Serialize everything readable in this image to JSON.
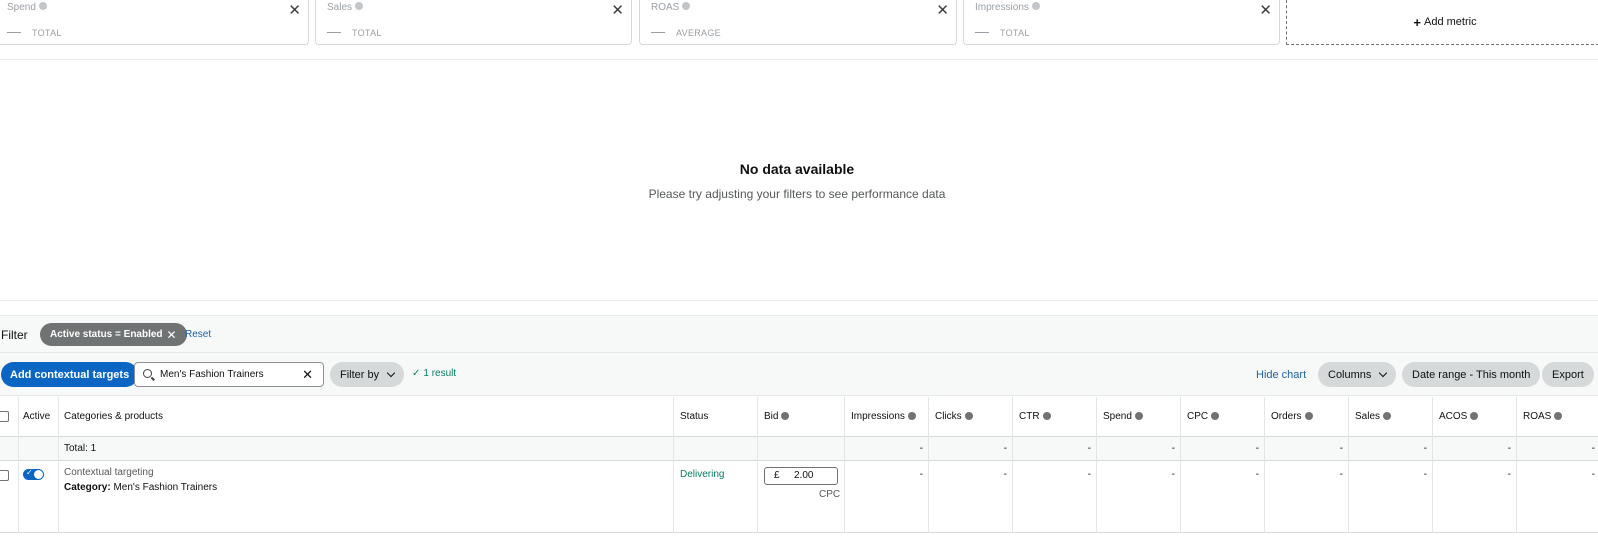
{
  "metrics": [
    {
      "name": "Spend",
      "aggregate": "TOTAL"
    },
    {
      "name": "Sales",
      "aggregate": "TOTAL"
    },
    {
      "name": "ROAS",
      "aggregate": "AVERAGE"
    },
    {
      "name": "Impressions",
      "aggregate": "TOTAL"
    }
  ],
  "add_metric_label": "Add metric",
  "chart": {
    "no_data_title": "No data available",
    "no_data_subtitle": "Please try adjusting your filters to see performance data"
  },
  "filter": {
    "label": "Filter",
    "chip": "Active status = Enabled",
    "reset": "Reset"
  },
  "toolbar": {
    "add_button": "Add contextual targets",
    "search_value": "Men's Fashion Trainers",
    "filter_by": "Filter by",
    "result": "1 result",
    "hide_chart": "Hide chart",
    "columns": "Columns",
    "date_range": "Date range - This month",
    "export": "Export"
  },
  "table": {
    "headers": {
      "active": "Active",
      "categories": "Categories & products",
      "status": "Status",
      "bid": "Bid",
      "impressions": "Impressions",
      "clicks": "Clicks",
      "ctr": "CTR",
      "spend": "Spend",
      "cpc": "CPC",
      "orders": "Orders",
      "sales": "Sales",
      "acos": "ACOS",
      "roas": "ROAS"
    },
    "total_label": "Total: 1",
    "total_values": [
      "-",
      "-",
      "-",
      "-",
      "-",
      "-",
      "-",
      "-",
      "-"
    ],
    "row": {
      "target_type": "Contextual targeting",
      "category_label": "Category:",
      "category_value": "Men's Fashion Trainers",
      "status": "Delivering",
      "bid_currency": "£",
      "bid_value": "2.00",
      "bid_type": "CPC",
      "values": [
        "-",
        "-",
        "-",
        "-",
        "-",
        "-",
        "-",
        "-",
        "-"
      ]
    }
  },
  "colors": {
    "primary": "#0a66c2",
    "delivering": "#067d62",
    "link": "#2162a1"
  }
}
